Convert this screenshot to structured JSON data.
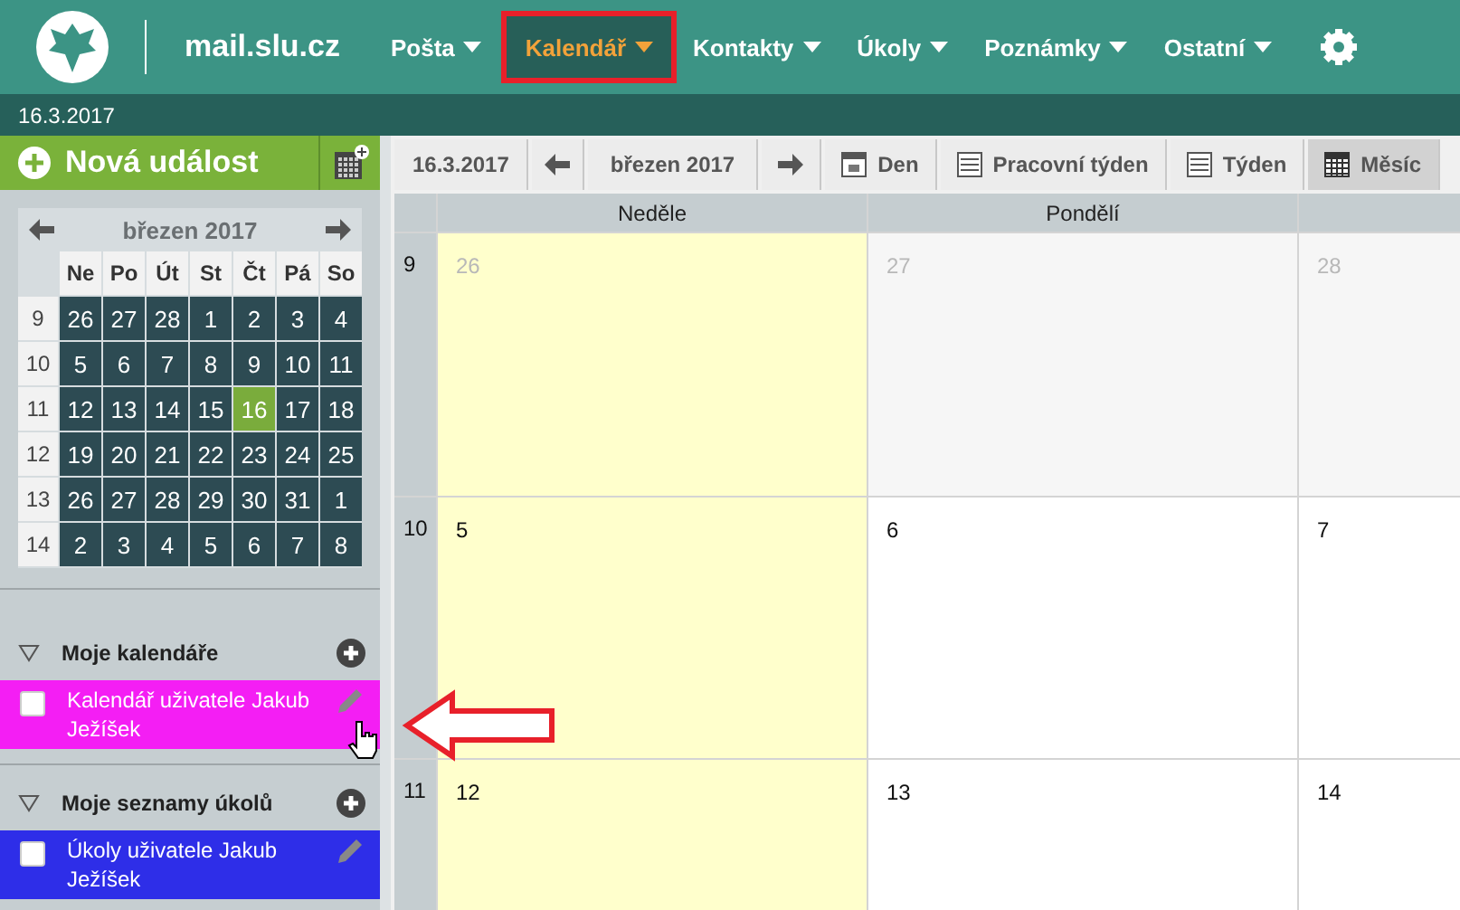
{
  "header": {
    "domain": "mail.slu.cz",
    "menu": [
      {
        "label": "Pošta",
        "selected": false
      },
      {
        "label": "Kalendář",
        "selected": true
      },
      {
        "label": "Kontakty",
        "selected": false
      },
      {
        "label": "Úkoly",
        "selected": false
      },
      {
        "label": "Poznámky",
        "selected": false
      },
      {
        "label": "Ostatní",
        "selected": false
      }
    ]
  },
  "date_bar": "16.3.2017",
  "sidebar": {
    "new_event": "Nová událost",
    "mini_calendar": {
      "title": "březen 2017",
      "weekdays": [
        "Ne",
        "Po",
        "Út",
        "St",
        "Čt",
        "Pá",
        "So"
      ],
      "weeks": [
        {
          "number": "9",
          "days": [
            {
              "label": "26",
              "selected": false
            },
            {
              "label": "27",
              "selected": false
            },
            {
              "label": "28",
              "selected": false
            },
            {
              "label": "1",
              "selected": false
            },
            {
              "label": "2",
              "selected": false
            },
            {
              "label": "3",
              "selected": false
            },
            {
              "label": "4",
              "selected": false
            }
          ]
        },
        {
          "number": "10",
          "days": [
            {
              "label": "5",
              "selected": false
            },
            {
              "label": "6",
              "selected": false
            },
            {
              "label": "7",
              "selected": false
            },
            {
              "label": "8",
              "selected": false
            },
            {
              "label": "9",
              "selected": false
            },
            {
              "label": "10",
              "selected": false
            },
            {
              "label": "11",
              "selected": false
            }
          ]
        },
        {
          "number": "11",
          "days": [
            {
              "label": "12",
              "selected": false
            },
            {
              "label": "13",
              "selected": false
            },
            {
              "label": "14",
              "selected": false
            },
            {
              "label": "15",
              "selected": false
            },
            {
              "label": "16",
              "selected": true
            },
            {
              "label": "17",
              "selected": false
            },
            {
              "label": "18",
              "selected": false
            }
          ]
        },
        {
          "number": "12",
          "days": [
            {
              "label": "19",
              "selected": false
            },
            {
              "label": "20",
              "selected": false
            },
            {
              "label": "21",
              "selected": false
            },
            {
              "label": "22",
              "selected": false
            },
            {
              "label": "23",
              "selected": false
            },
            {
              "label": "24",
              "selected": false
            },
            {
              "label": "25",
              "selected": false
            }
          ]
        },
        {
          "number": "13",
          "days": [
            {
              "label": "26",
              "selected": false
            },
            {
              "label": "27",
              "selected": false
            },
            {
              "label": "28",
              "selected": false
            },
            {
              "label": "29",
              "selected": false
            },
            {
              "label": "30",
              "selected": false
            },
            {
              "label": "31",
              "selected": false
            },
            {
              "label": "1",
              "selected": false
            }
          ]
        },
        {
          "number": "14",
          "days": [
            {
              "label": "2",
              "selected": false
            },
            {
              "label": "3",
              "selected": false
            },
            {
              "label": "4",
              "selected": false
            },
            {
              "label": "5",
              "selected": false
            },
            {
              "label": "6",
              "selected": false
            },
            {
              "label": "7",
              "selected": false
            },
            {
              "label": "8",
              "selected": false
            }
          ]
        }
      ]
    },
    "sections": [
      {
        "title": "Moje kalendáře",
        "items": [
          {
            "label": "Kalendář uživatele Jakub Ježíšek",
            "color": "#f41ef4",
            "checked": false
          }
        ]
      },
      {
        "title": "Moje seznamy úkolů",
        "items": [
          {
            "label": "Úkoly uživatele Jakub Ježíšek",
            "color": "#2e2ee8",
            "checked": false
          }
        ]
      }
    ]
  },
  "toolbar": {
    "date": "16.3.2017",
    "month": "březen 2017",
    "views": [
      {
        "label": "Den",
        "kind": "day",
        "selected": false
      },
      {
        "label": "Pracovní týden",
        "kind": "list",
        "selected": false
      },
      {
        "label": "Týden",
        "kind": "list",
        "selected": false
      },
      {
        "label": "Měsíc",
        "kind": "grid",
        "selected": true
      }
    ]
  },
  "grid": {
    "columns": [
      {
        "label": "Neděle",
        "weekend": true
      },
      {
        "label": "Pondělí",
        "weekend": false
      },
      {
        "weekend": false
      }
    ],
    "weeks": [
      {
        "number": "9",
        "days": [
          {
            "label": "26",
            "in_month": false
          },
          {
            "label": "27",
            "in_month": false
          },
          {
            "label": "28",
            "in_month": false
          }
        ]
      },
      {
        "number": "10",
        "days": [
          {
            "label": "5",
            "in_month": true
          },
          {
            "label": "6",
            "in_month": true
          },
          {
            "label": "7",
            "in_month": true
          }
        ]
      },
      {
        "number": "11",
        "days": [
          {
            "label": "12",
            "in_month": true
          },
          {
            "label": "13",
            "in_month": true
          },
          {
            "label": "14",
            "in_month": true
          }
        ]
      }
    ]
  }
}
